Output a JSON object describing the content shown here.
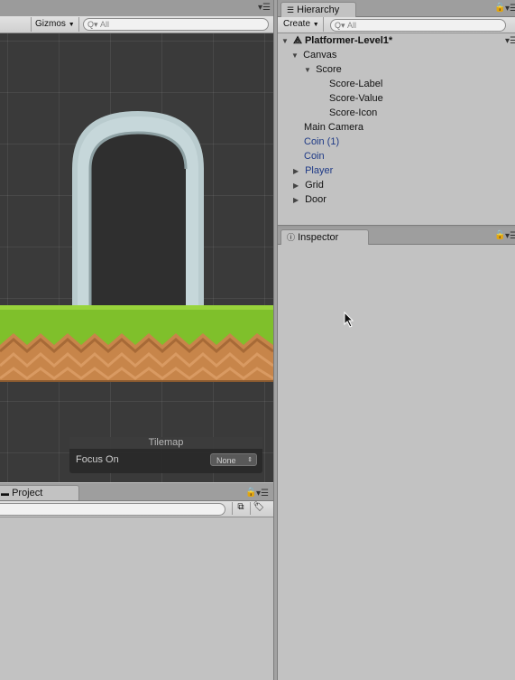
{
  "scene": {
    "gizmos_label": "Gizmos",
    "search_placeholder": "All",
    "tilemap": {
      "title": "Tilemap",
      "focus_label": "Focus On",
      "focus_value": "None"
    }
  },
  "hierarchy": {
    "tab_label": "Hierarchy",
    "create_label": "Create",
    "search_placeholder": "All",
    "scene_name": "Platformer-Level1*",
    "items": [
      {
        "label": "Canvas"
      },
      {
        "label": "Score"
      },
      {
        "label": "Score-Label"
      },
      {
        "label": "Score-Value"
      },
      {
        "label": "Score-Icon"
      },
      {
        "label": "Main Camera"
      },
      {
        "label": "Coin (1)"
      },
      {
        "label": "Coin"
      },
      {
        "label": "Player"
      },
      {
        "label": "Grid"
      },
      {
        "label": "Door"
      }
    ]
  },
  "inspector": {
    "tab_label": "Inspector"
  },
  "project": {
    "tab_label": "Project"
  },
  "colors": {
    "grass": "#7cc02a",
    "dirt": "#c9894f",
    "door_frame": "#b7c9cc",
    "prefab_blue": "#1f3a86"
  }
}
